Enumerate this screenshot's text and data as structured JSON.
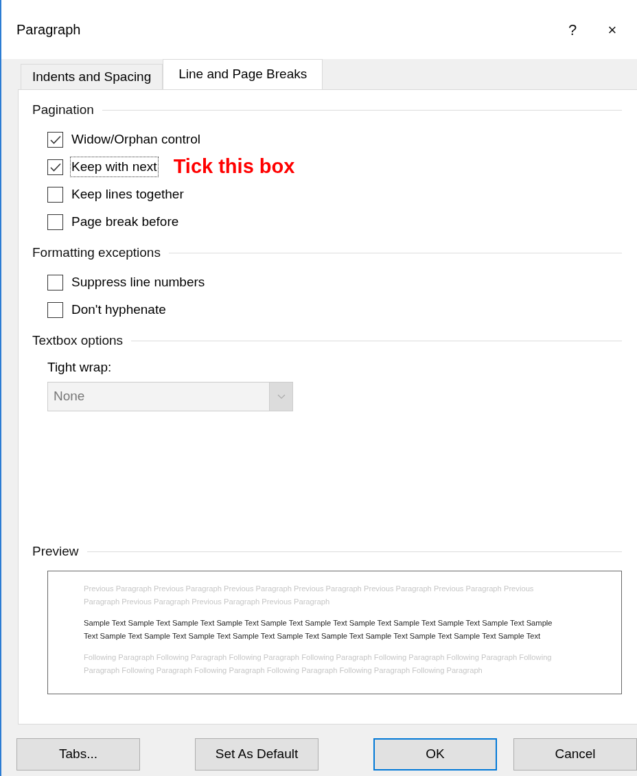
{
  "window": {
    "title": "Paragraph",
    "help": "?",
    "close": "×"
  },
  "tabs": [
    {
      "label": "Indents and Spacing",
      "selected": false
    },
    {
      "label": "Line and Page Breaks",
      "selected": true
    }
  ],
  "sections": [
    {
      "heading": "Pagination",
      "options": [
        {
          "label": "Widow/Orphan control",
          "checked": true,
          "focused": false
        },
        {
          "label": "Keep with next",
          "checked": true,
          "focused": true,
          "annotation": "Tick this box"
        },
        {
          "label": "Keep lines together",
          "checked": false,
          "focused": false
        },
        {
          "label": "Page break before",
          "checked": false,
          "focused": false
        }
      ]
    },
    {
      "heading": "Formatting exceptions",
      "options": [
        {
          "label": "Suppress line numbers",
          "checked": false,
          "focused": false
        },
        {
          "label": "Don't hyphenate",
          "checked": false,
          "focused": false
        }
      ]
    },
    {
      "heading": "Textbox options",
      "dropdown": {
        "label": "Tight wrap:",
        "value": "None",
        "disabled": true
      }
    }
  ],
  "preview": {
    "heading": "Preview",
    "previous": "Previous Paragraph Previous Paragraph Previous Paragraph Previous Paragraph Previous Paragraph Previous Paragraph Previous Paragraph Previous Paragraph Previous Paragraph Previous Paragraph",
    "sample": "Sample Text Sample Text Sample Text Sample Text Sample Text Sample Text Sample Text Sample Text Sample Text Sample Text Sample Text Sample Text Sample Text Sample Text Sample Text Sample Text Sample Text Sample Text Sample Text Sample Text Sample Text",
    "following": "Following Paragraph Following Paragraph Following Paragraph Following Paragraph Following Paragraph Following Paragraph Following Paragraph Following Paragraph Following Paragraph Following Paragraph Following Paragraph Following Paragraph"
  },
  "buttons": [
    {
      "label": "Tabs...",
      "default": false
    },
    {
      "label": "Set As Default",
      "default": false
    },
    {
      "label": "OK",
      "default": true
    },
    {
      "label": "Cancel",
      "default": false
    }
  ]
}
